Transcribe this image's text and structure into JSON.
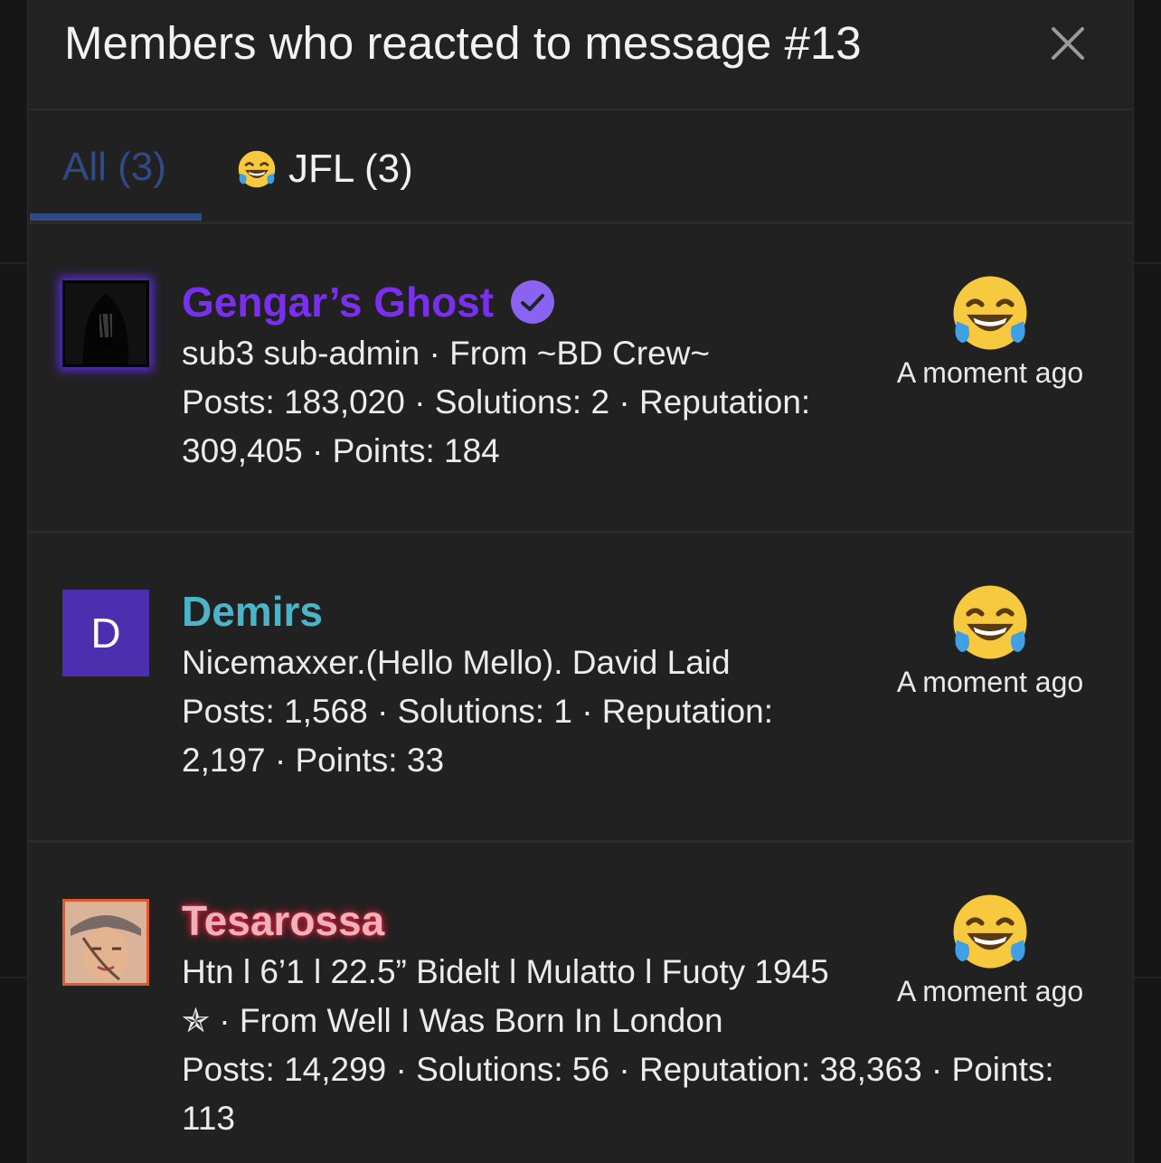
{
  "dialog": {
    "title": "Members who reacted to message #13"
  },
  "tabs": [
    {
      "label": "All (3)",
      "active": true
    },
    {
      "label": "JFL (3)",
      "icon": "laughing-crying-emoji",
      "active": false
    }
  ],
  "members": [
    {
      "name": "Gengar’s Ghost",
      "verified": true,
      "title_line": "sub3 sub-admin · From ~BD Crew~",
      "stats_line_1": "Posts: 183,020 · Solutions: 2 · Reputation:",
      "stats_line_2": "309,405 · Points: 184",
      "reaction": "laughing-crying-emoji",
      "time": "A moment ago",
      "name_color": "#7a2ff0"
    },
    {
      "name": "Demirs",
      "avatar_letter": "D",
      "title_line": "Nicemaxxer.(Hello Mello). David Laid",
      "stats_line_1": "Posts: 1,568 · Solutions: 1 · Reputation:",
      "stats_line_2": "2,197 · Points: 33",
      "reaction": "laughing-crying-emoji",
      "time": "A moment ago",
      "name_color": "#4ab5c9",
      "avatar_color": "#4b2fae"
    },
    {
      "name": "Tesarossa",
      "title_line": "Htn l 6’1 l 22.5” Bidelt l Mulatto l Fuoty 1945",
      "title_line_2": "✯ · From Well I Was Born In London",
      "stats_line_1": "Posts: 14,299 · Solutions: 56 · Reputation: 38,363 · Points:",
      "stats_line_2": "113",
      "reaction": "laughing-crying-emoji",
      "time": "A moment ago",
      "name_color": "#f0b2ba"
    }
  ],
  "colors": {
    "background": "#212121",
    "accent_tab": "#2f4a86",
    "verified_badge": "#8a63f0"
  }
}
